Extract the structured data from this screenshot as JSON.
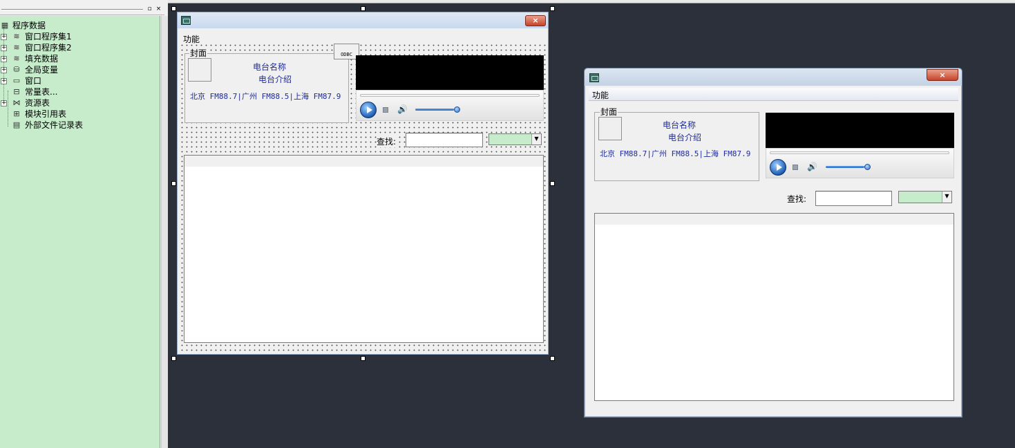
{
  "tree": {
    "root_label": "程序数据",
    "items": [
      {
        "label": "窗口程序集1",
        "icon": "layers-icon",
        "expandable": true
      },
      {
        "label": "窗口程序集2",
        "icon": "layers-icon",
        "expandable": true
      },
      {
        "label": "填充数据",
        "icon": "layers-icon",
        "expandable": true
      },
      {
        "label": "全局变量",
        "icon": "globe-icon",
        "expandable": true
      },
      {
        "label": "窗口",
        "icon": "window-icon",
        "expandable": true
      },
      {
        "label": "常量表...",
        "icon": "constants-icon",
        "expandable": false
      },
      {
        "label": "资源表",
        "icon": "resources-icon",
        "expandable": true
      },
      {
        "label": "模块引用表",
        "icon": "module-icon",
        "expandable": false
      },
      {
        "label": "外部文件记录表",
        "icon": "file-icon",
        "expandable": false
      }
    ]
  },
  "panel_buttons": {
    "restore": "▫",
    "close": "×"
  },
  "design_window": {
    "menu": "功能",
    "cover_group_title": "封面",
    "station_name": "电台名称",
    "station_intro": "电台介绍",
    "stations_line": "北京 FM88.7|广州 FM88.5|上海 FM87.9",
    "search_label": "查找:",
    "search_value": "",
    "odbc_label": "ODBC",
    "close_glyph": "×"
  },
  "preview_window": {
    "menu": "功能",
    "cover_group_title": "封面",
    "station_name": "电台名称",
    "station_intro": "电台介绍",
    "stations_line": "北京 FM88.7|广州 FM88.5|上海 FM87.9",
    "search_label": "查找:",
    "search_value": "",
    "close_glyph": "×"
  },
  "player": {
    "volume_level": 0.85
  },
  "colors": {
    "tree_bg": "#c6eccb",
    "workspace_bg": "#2c303a",
    "accent_text": "#1d2b9c"
  }
}
